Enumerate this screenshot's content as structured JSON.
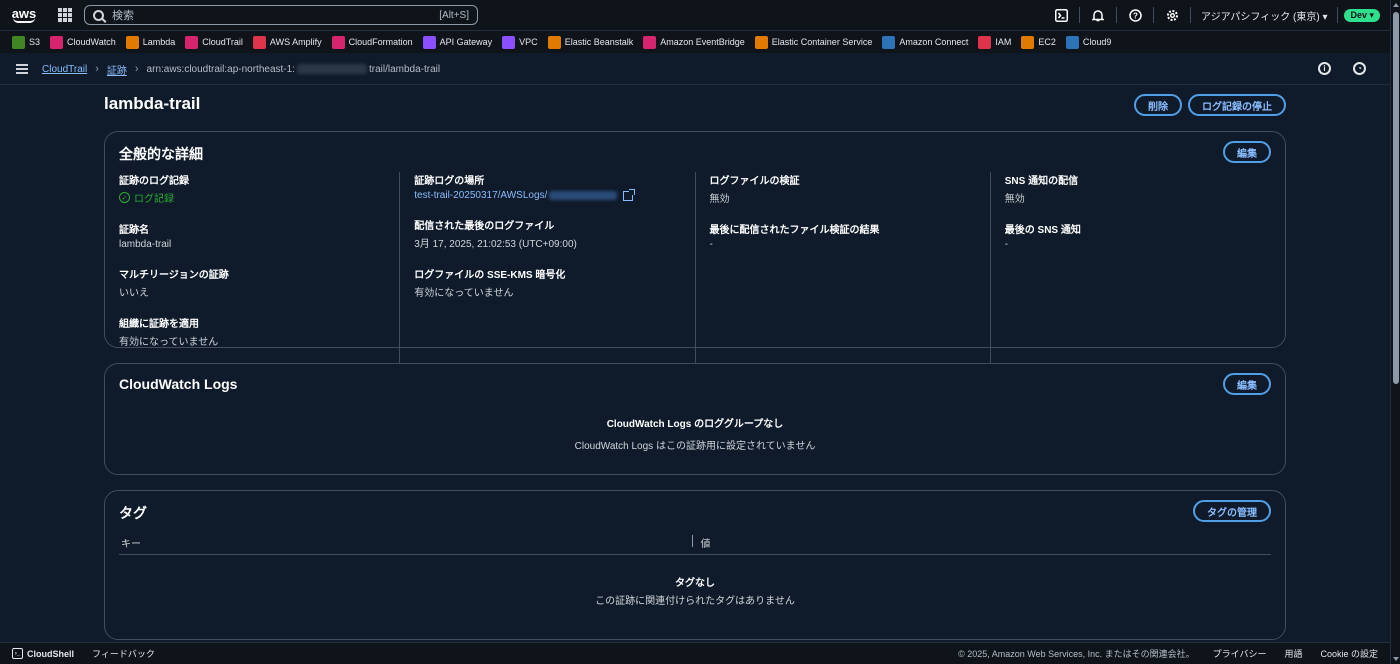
{
  "topnav": {
    "logo_text": "aws",
    "search_placeholder": "検索",
    "search_shortcut": "[Alt+S]",
    "region": "アジアパシフィック (東京) ▾",
    "account_badge": "Dev ▾"
  },
  "favorites": [
    {
      "label": "S3",
      "icon": "s3-icon",
      "color": "#3f8624"
    },
    {
      "label": "CloudWatch",
      "icon": "cloudwatch-icon",
      "color": "#d6246e"
    },
    {
      "label": "Lambda",
      "icon": "lambda-icon",
      "color": "#e07b00"
    },
    {
      "label": "CloudTrail",
      "icon": "cloudtrail-icon",
      "color": "#d6246e"
    },
    {
      "label": "AWS Amplify",
      "icon": "amplify-icon",
      "color": "#dd344c"
    },
    {
      "label": "CloudFormation",
      "icon": "cloudformation-icon",
      "color": "#d6246e"
    },
    {
      "label": "API Gateway",
      "icon": "api-gateway-icon",
      "color": "#8c4fff"
    },
    {
      "label": "VPC",
      "icon": "vpc-icon",
      "color": "#8c4fff"
    },
    {
      "label": "Elastic Beanstalk",
      "icon": "elastic-beanstalk-icon",
      "color": "#e07b00"
    },
    {
      "label": "Amazon EventBridge",
      "icon": "eventbridge-icon",
      "color": "#d6246e"
    },
    {
      "label": "Elastic Container Service",
      "icon": "ecs-icon",
      "color": "#e07b00"
    },
    {
      "label": "Amazon Connect",
      "icon": "connect-icon",
      "color": "#2e73b8"
    },
    {
      "label": "IAM",
      "icon": "iam-icon",
      "color": "#dd344c"
    },
    {
      "label": "EC2",
      "icon": "ec2-icon",
      "color": "#e07b00"
    },
    {
      "label": "Cloud9",
      "icon": "cloud9-icon",
      "color": "#2e73b8"
    }
  ],
  "breadcrumb": {
    "items": [
      "CloudTrail",
      "証跡"
    ],
    "current_prefix": "arn:aws:cloudtrail:ap-northeast-1:",
    "current_suffix": "trail/lambda-trail"
  },
  "page": {
    "title": "lambda-trail",
    "delete_button": "削除",
    "stop_logging_button": "ログ記録の停止"
  },
  "general": {
    "title": "全般的な詳細",
    "edit_button": "編集",
    "col1": [
      {
        "key": "証跡のログ記録",
        "value": "ログ記録",
        "status": "ok"
      },
      {
        "key": "証跡名",
        "value": "lambda-trail"
      },
      {
        "key": "マルチリージョンの証跡",
        "value": "いいえ"
      },
      {
        "key": "組織に証跡を適用",
        "value": "有効になっていません"
      }
    ],
    "col2": [
      {
        "key": "証跡ログの場所",
        "value": "test-trail-20250317/AWSLogs/"
      },
      {
        "key": "配信された最後のログファイル",
        "value": "3月 17, 2025, 21:02:53 (UTC+09:00)"
      },
      {
        "key": "ログファイルの SSE-KMS 暗号化",
        "value": "有効になっていません"
      }
    ],
    "col3": [
      {
        "key": "ログファイルの検証",
        "value": "無効"
      },
      {
        "key": "最後に配信されたファイル検証の結果",
        "value": "-"
      }
    ],
    "col4": [
      {
        "key": "SNS 通知の配信",
        "value": "無効"
      },
      {
        "key": "最後の SNS 通知",
        "value": "-"
      }
    ]
  },
  "cloudwatch": {
    "title": "CloudWatch Logs",
    "edit_button": "編集",
    "empty_title": "CloudWatch Logs のロググループなし",
    "empty_desc": "CloudWatch Logs はこの証跡用に設定されていません"
  },
  "tags": {
    "title": "タグ",
    "manage_button": "タグの管理",
    "col_key": "キー",
    "col_value": "値",
    "empty_title": "タグなし",
    "empty_desc": "この証跡に関連付けられたタグはありません"
  },
  "footer": {
    "cloudshell": "CloudShell",
    "feedback": "フィードバック",
    "copyright": "© 2025, Amazon Web Services, Inc. またはその関連会社。",
    "privacy": "プライバシー",
    "terms": "用語",
    "cookie": "Cookie の設定"
  }
}
